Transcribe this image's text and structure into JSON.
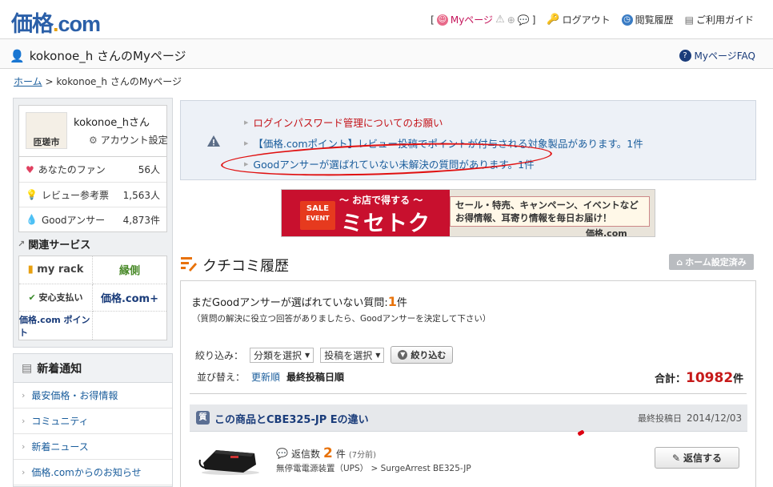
{
  "header": {
    "logo_main": "価格",
    "logo_dot": ".",
    "logo_com": "com",
    "bracket_open": "[",
    "bracket_close": "]",
    "nav": {
      "mypage": "Myページ",
      "logout": "ログアウト",
      "history": "閲覧履歴",
      "guide": "ご利用ガイド"
    }
  },
  "title_bar": {
    "title": "kokonoe_h さんのMyページ",
    "faq": "MyページFAQ"
  },
  "breadcrumb": {
    "home": "ホーム",
    "sep": ">",
    "current": "kokonoe_h さんのMyページ"
  },
  "sidebar": {
    "user_name": "kokonoe_hさん",
    "avatar_text": "匝瑳市",
    "account_settings": "アカウント設定",
    "stats": [
      {
        "label": "あなたのファン",
        "value": "56人"
      },
      {
        "label": "レビュー参考票",
        "value": "1,563人"
      },
      {
        "label": "Goodアンサー",
        "value": "4,873件"
      }
    ],
    "related_title": "関連サービス",
    "services": [
      "my rack",
      "縁側",
      "安心支払い",
      "価格.com+",
      "価格.com ポイント",
      ""
    ],
    "news_title": "新着通知",
    "news_items": [
      "最安価格・お得情報",
      "コミュニティ",
      "新着ニュース",
      "価格.comからのお知らせ"
    ]
  },
  "notice": {
    "lines": [
      "ログインパスワード管理についてのお願い",
      "【価格.comポイント】レビュー投稿でポイントが付与される対象製品があります。1件",
      "Goodアンサーが選ばれていない未解決の質問があります。1件"
    ]
  },
  "banner": {
    "sale_top": "SALE",
    "sale_bottom": "EVENT",
    "subtitle": "〜 お店で得する 〜",
    "main": "ミセトク",
    "desc": "セール・特売、キャンペーン、イベントなど お得情報、耳寄り情報を毎日お届け！",
    "logo": "価格.com"
  },
  "kuchikomi": {
    "title": "クチコミ履歴",
    "home_btn": "ホーム設定済み",
    "question_prefix": "まだGoodアンサーが選ばれていない質問:",
    "question_count": "1",
    "question_suffix": "件",
    "question_note": "（質問の解決に役立つ回答がありましたら、Goodアンサーを決定して下さい）",
    "filter_label": "絞り込み：",
    "filter_category": "分類を選択",
    "filter_post": "投稿を選択",
    "filter_button": "絞り込む",
    "sort_label": "並び替え：",
    "sort_new": "更新順",
    "sort_last": "最終投稿日順",
    "total_label": "合計：",
    "total_value": "10982",
    "total_unit": "件",
    "item": {
      "icon": "質",
      "title": "この商品とCBE325-JP Eの違い",
      "date_label": "最終投稿日",
      "date": "2014/12/03",
      "reply_label": "返信数",
      "reply_count": "2",
      "reply_unit": "件",
      "reply_ago": "(7分前)",
      "category": "無停電電源装置（UPS） > SurgeArrest BE325-JP",
      "reply_button": "返信する"
    }
  }
}
